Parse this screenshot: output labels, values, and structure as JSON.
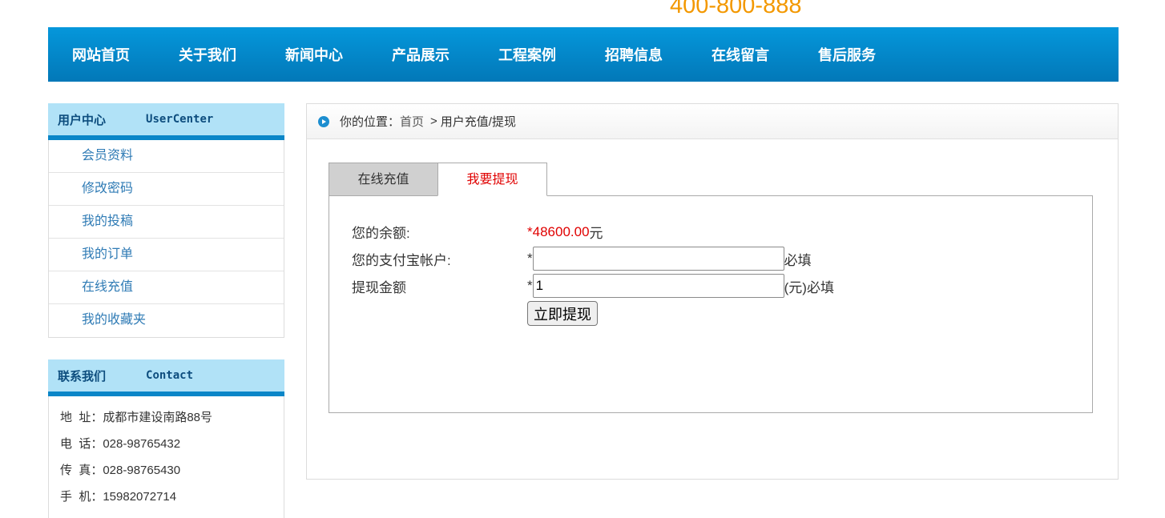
{
  "header": {
    "hotline": "400-800-888"
  },
  "nav": [
    "网站首页",
    "关于我们",
    "新闻中心",
    "产品展示",
    "工程案例",
    "招聘信息",
    "在线留言",
    "售后服务"
  ],
  "sidebar": {
    "user_center": {
      "title_cn": "用户中心",
      "title_en": "UserCenter",
      "items": [
        "会员资料",
        "修改密码",
        "我的投稿",
        "我的订单",
        "在线充值",
        "我的收藏夹"
      ]
    },
    "contact": {
      "title_cn": "联系我们",
      "title_en": "Contact",
      "rows": [
        "地  址：成都市建设南路88号",
        "电  话：028-98765432",
        "传  真：028-98765430",
        "手  机：15982072714"
      ]
    }
  },
  "breadcrumb": {
    "prefix": "你的位置：",
    "home": "首页",
    "sep": ">",
    "current": "用户充值/提现"
  },
  "tabs": [
    {
      "label": "在线充值",
      "active": false
    },
    {
      "label": "我要提现",
      "active": true
    }
  ],
  "form": {
    "balance_label": "您的余额:",
    "required_mark": "*",
    "balance_value": "48600.00",
    "balance_unit": "元",
    "alipay_label": "您的支付宝帐户:",
    "alipay_value": "",
    "alipay_suffix": "必填",
    "amount_label": "提现金额",
    "amount_value": "1",
    "amount_suffix": "(元)必填",
    "submit_label": "立即提现"
  },
  "colors": {
    "nav_blue": "#0288cc",
    "accent_orange": "#f39800",
    "highlight_red": "#e00000",
    "sidebar_head_bg": "#b1e2f7"
  }
}
